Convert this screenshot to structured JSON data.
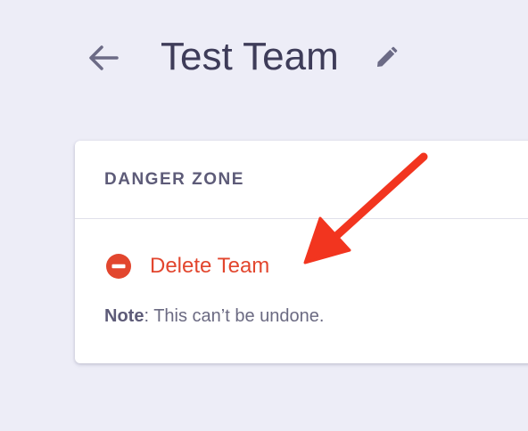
{
  "header": {
    "title": "Test Team",
    "back_icon": "arrow-left-icon",
    "edit_icon": "pencil-icon"
  },
  "danger_zone": {
    "title": "DANGER ZONE",
    "delete_label": "Delete Team",
    "delete_icon": "minus-circle-icon",
    "note_label": "Note",
    "note_text": ": This can’t be undone."
  },
  "annotation": {
    "arrow_icon": "annotation-arrow-icon"
  },
  "colors": {
    "background": "#ededf7",
    "title_text": "#3e3c59",
    "danger": "#e2462e",
    "annotation_arrow": "#f2351f",
    "muted_text": "#6b6a82"
  }
}
